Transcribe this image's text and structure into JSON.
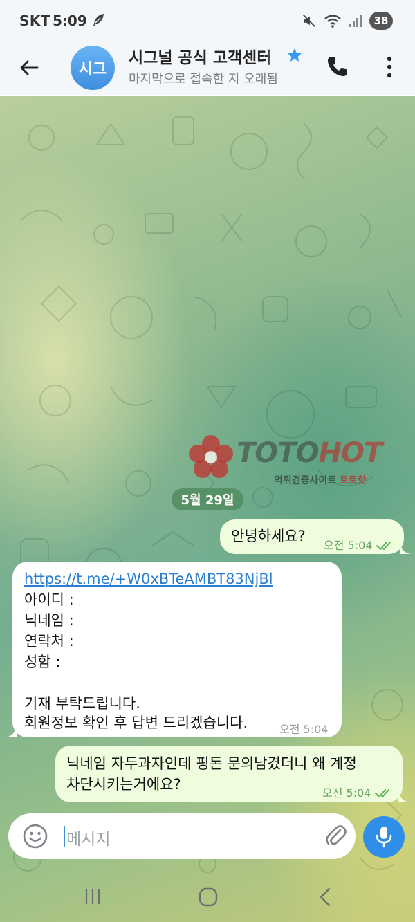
{
  "status_bar": {
    "carrier": "SKT",
    "time": "5:09",
    "battery": "38",
    "icons": [
      "feather-icon",
      "mute-icon",
      "wifi-icon",
      "signal-icon",
      "battery-icon"
    ]
  },
  "header": {
    "avatar_text": "시그",
    "title": "시그널 공식 고객센터",
    "subtitle": "마지막으로 접속한 지 오래됨",
    "verified_color": "#3a9bee"
  },
  "watermark": {
    "logo_main": "TOTO",
    "logo_accent": "HOT",
    "sub_main": "먹튀검증사이트 ",
    "sub_accent": "토토핫"
  },
  "chat": {
    "date": "5월 29일",
    "messages": [
      {
        "direction": "out",
        "text": "안녕하세요?",
        "time": "오전 5:04",
        "status": "read"
      },
      {
        "direction": "in",
        "link": "https://t.me/+W0xBTeAMBT83NjBl",
        "lines": [
          "아이디 :",
          "닉네임 :",
          "연락처 :",
          "성함 :",
          "",
          "기재 부탁드립니다.",
          "회원정보 확인 후 답변 드리겠습니다."
        ],
        "time": "오전 5:04"
      },
      {
        "direction": "out",
        "lines": [
          "닉네임 자두과자인데 핑돈 문의남겼더니 왜 계정",
          "차단시키는거에요?"
        ],
        "time": "오전 5:04",
        "status": "read"
      }
    ]
  },
  "composer": {
    "placeholder": "메시지"
  },
  "colors": {
    "outgoing_bubble": "#effdde",
    "incoming_bubble": "#ffffff",
    "link": "#2a7fd1",
    "accent": "#2f8fe8",
    "date_chip": "#528c60"
  }
}
